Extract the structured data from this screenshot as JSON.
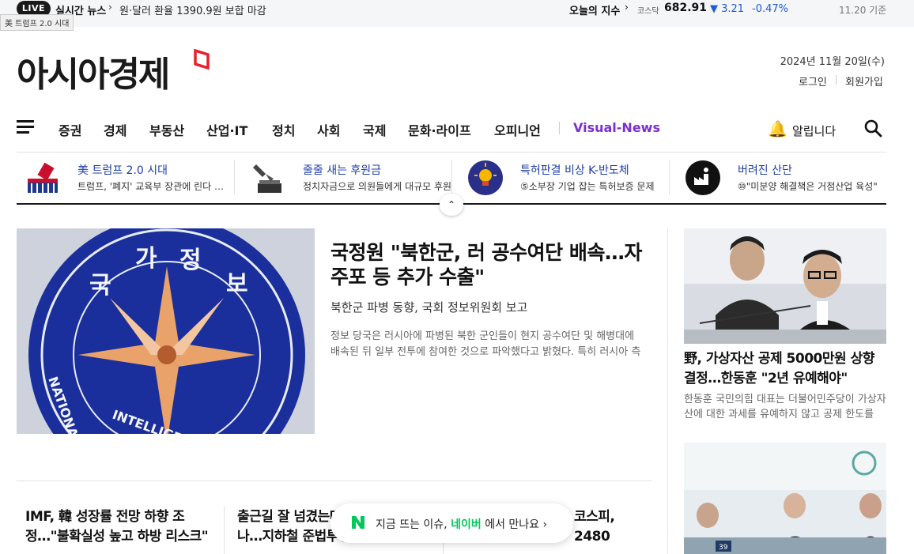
{
  "ticker": {
    "live_label": "LIVE",
    "title": "실시간 뉴스",
    "headline": "원·달러 환율 1390.9원 보합 마감",
    "tooltip": "美 트럼프 2.0 시대",
    "index_label": "오늘의 지수",
    "index_name": "코스닥",
    "index_value": "682.91",
    "index_change": "▼ 3.21",
    "index_pct": "-0.47%",
    "index_date": "11.20 기준"
  },
  "header": {
    "logo": "아시아경제",
    "date": "2024년 11월 20일(수)",
    "login": "로그인",
    "join": "회원가입"
  },
  "nav": {
    "items": [
      "증권",
      "경제",
      "부동산",
      "산업·IT",
      "정치",
      "사회",
      "국제",
      "문화·라이프",
      "오피니언"
    ],
    "visual": "Visual-News",
    "notify": "알립니다"
  },
  "issues": [
    {
      "title": "美 트럼프 2.0 시대",
      "desc": "트럼프, '폐지' 교육부 장관에 린다 맥마흔"
    },
    {
      "title": "줄줄 새는 후원금",
      "desc": "정치자금으로 의원들에게 대규모 후원"
    },
    {
      "title": "특허판결 비상 K-반도체",
      "desc": "⑤소부장 기업 잡는 특허보증 문제"
    },
    {
      "title": "버려진 산단",
      "desc": "⑩\"미분양 해결책은 거점산업 육성\""
    }
  ],
  "lead": {
    "headline": "국정원 \"북한군, 러 공수여단 배속…자주포 등 추가 수출\"",
    "sub": "북한군 파병 동향, 국회 정보위원회 보고",
    "body": "정보 당국은 러시아에 파병된 북한 군인들이 현지 공수여단 및 해병대에 배속된 뒤 일부 전투에 참여한 것으로 파악했다고 밝혔다. 특히 러시아 측에"
  },
  "sub_items": [
    "IMF, 韓 성장률 전망 하향 조정…\"불확실성 높고 하방 리스크\"",
    "출근길 잘 넘겼는데 또 파업 예고 나…지하철 준법투쟁",
    "코스피, 2480"
  ],
  "side": {
    "headline": "野, 가상자산 공제 5000만원 상향 결정…한동훈 \"2년 유예해야\"",
    "body": "한동훈 국민의힘 대표는 더불어민주당이 가상자산에 대한 과세를 유예하지 않고 공제 한도를 상향"
  },
  "naver_popup": {
    "prefix": "지금 뜨는 이슈,",
    "brand": "네이버",
    "suffix": "에서 만나요 ›"
  },
  "colors": {
    "accent_red": "#e8202a",
    "visual_purple": "#7b2fd0",
    "index_blue": "#1e5bd6",
    "naver_green": "#03c75a"
  }
}
